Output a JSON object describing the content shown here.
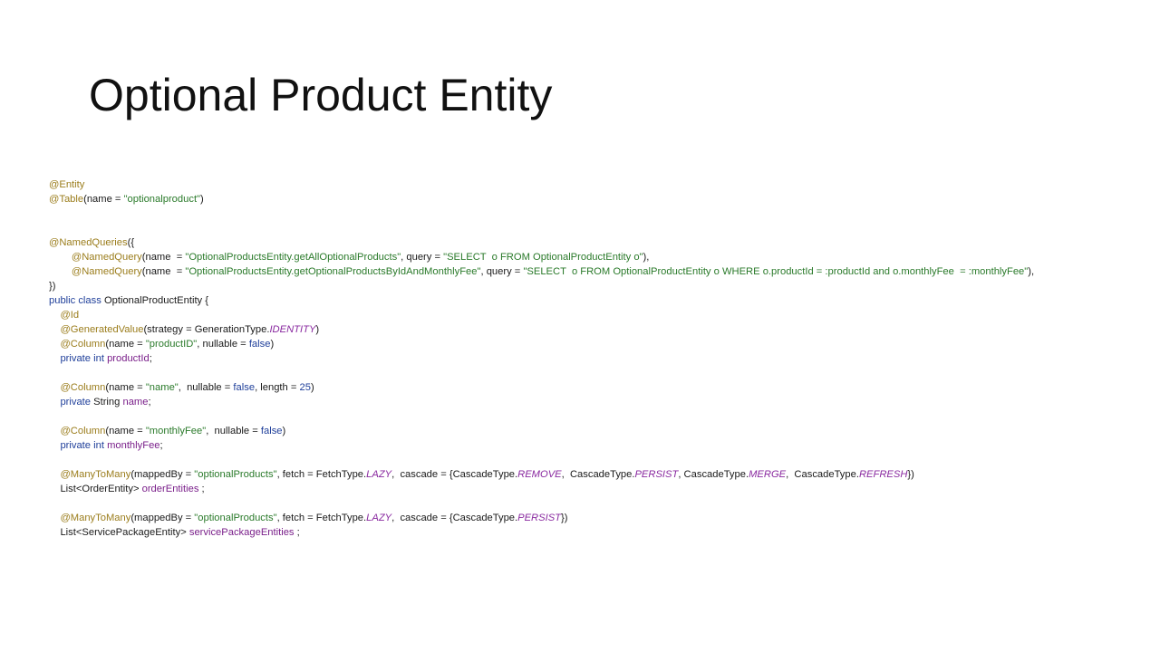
{
  "slide": {
    "title": "Optional Product Entity"
  },
  "colors": {
    "annotation": "#9b7d1c",
    "string": "#2a7a2a",
    "keyword": "#1f3f9a",
    "enum_constant": "#8a2aa0",
    "field": "#7a1f8a",
    "text": "#1a1a1a"
  },
  "code": {
    "lines": [
      {
        "tokens": [
          {
            "t": "@Entity",
            "c": "ann"
          }
        ]
      },
      {
        "tokens": [
          {
            "t": "@Table",
            "c": "ann"
          },
          {
            "t": "(name = ",
            "c": "plain"
          },
          {
            "t": "\"optionalproduct\"",
            "c": "str"
          },
          {
            "t": ")",
            "c": "plain"
          }
        ]
      },
      {
        "tokens": []
      },
      {
        "tokens": []
      },
      {
        "tokens": [
          {
            "t": "@NamedQueries",
            "c": "ann"
          },
          {
            "t": "({",
            "c": "plain"
          }
        ]
      },
      {
        "tokens": [
          {
            "t": "        ",
            "c": "plain"
          },
          {
            "t": "@NamedQuery",
            "c": "ann"
          },
          {
            "t": "(name  = ",
            "c": "plain"
          },
          {
            "t": "\"OptionalProductsEntity.getAllOptionalProducts\"",
            "c": "str"
          },
          {
            "t": ", query = ",
            "c": "plain"
          },
          {
            "t": "\"SELECT  o FROM OptionalProductEntity o\"",
            "c": "str"
          },
          {
            "t": "),",
            "c": "plain"
          }
        ]
      },
      {
        "tokens": [
          {
            "t": "        ",
            "c": "plain"
          },
          {
            "t": "@NamedQuery",
            "c": "ann"
          },
          {
            "t": "(name  = ",
            "c": "plain"
          },
          {
            "t": "\"OptionalProductsEntity.getOptionalProductsByIdAndMonthlyFee\"",
            "c": "str"
          },
          {
            "t": ", query = ",
            "c": "plain"
          },
          {
            "t": "\"SELECT  o FROM OptionalProductEntity o WHERE o.productId = :productId and o.monthlyFee  = :monthlyFee\"",
            "c": "str"
          },
          {
            "t": "),",
            "c": "plain"
          }
        ]
      },
      {
        "tokens": [
          {
            "t": "})",
            "c": "plain"
          }
        ]
      },
      {
        "tokens": [
          {
            "t": "public class ",
            "c": "kw"
          },
          {
            "t": "OptionalProductEntity {",
            "c": "plain"
          }
        ]
      },
      {
        "tokens": [
          {
            "t": "    ",
            "c": "plain"
          },
          {
            "t": "@Id",
            "c": "ann"
          }
        ]
      },
      {
        "tokens": [
          {
            "t": "    ",
            "c": "plain"
          },
          {
            "t": "@GeneratedValue",
            "c": "ann"
          },
          {
            "t": "(strategy = GenerationType.",
            "c": "plain"
          },
          {
            "t": "IDENTITY",
            "c": "const"
          },
          {
            "t": ")",
            "c": "plain"
          }
        ]
      },
      {
        "tokens": [
          {
            "t": "    ",
            "c": "plain"
          },
          {
            "t": "@Column",
            "c": "ann"
          },
          {
            "t": "(name = ",
            "c": "plain"
          },
          {
            "t": "\"productID\"",
            "c": "str"
          },
          {
            "t": ", nullable = ",
            "c": "plain"
          },
          {
            "t": "false",
            "c": "kw"
          },
          {
            "t": ")",
            "c": "plain"
          }
        ]
      },
      {
        "tokens": [
          {
            "t": "    ",
            "c": "plain"
          },
          {
            "t": "private int ",
            "c": "kw"
          },
          {
            "t": "productId",
            "c": "field"
          },
          {
            "t": ";",
            "c": "plain"
          }
        ]
      },
      {
        "tokens": []
      },
      {
        "tokens": [
          {
            "t": "    ",
            "c": "plain"
          },
          {
            "t": "@Column",
            "c": "ann"
          },
          {
            "t": "(name = ",
            "c": "plain"
          },
          {
            "t": "\"name\"",
            "c": "str"
          },
          {
            "t": ",  nullable = ",
            "c": "plain"
          },
          {
            "t": "false",
            "c": "kw"
          },
          {
            "t": ", length = ",
            "c": "plain"
          },
          {
            "t": "25",
            "c": "num"
          },
          {
            "t": ")",
            "c": "plain"
          }
        ]
      },
      {
        "tokens": [
          {
            "t": "    ",
            "c": "plain"
          },
          {
            "t": "private ",
            "c": "kw"
          },
          {
            "t": "String ",
            "c": "plain"
          },
          {
            "t": "name",
            "c": "field"
          },
          {
            "t": ";",
            "c": "plain"
          }
        ]
      },
      {
        "tokens": []
      },
      {
        "tokens": [
          {
            "t": "    ",
            "c": "plain"
          },
          {
            "t": "@Column",
            "c": "ann"
          },
          {
            "t": "(name = ",
            "c": "plain"
          },
          {
            "t": "\"monthlyFee\"",
            "c": "str"
          },
          {
            "t": ",  nullable = ",
            "c": "plain"
          },
          {
            "t": "false",
            "c": "kw"
          },
          {
            "t": ")",
            "c": "plain"
          }
        ]
      },
      {
        "tokens": [
          {
            "t": "    ",
            "c": "plain"
          },
          {
            "t": "private int ",
            "c": "kw"
          },
          {
            "t": "monthlyFee",
            "c": "field"
          },
          {
            "t": ";",
            "c": "plain"
          }
        ]
      },
      {
        "tokens": []
      },
      {
        "tokens": [
          {
            "t": "    ",
            "c": "plain"
          },
          {
            "t": "@ManyToMany",
            "c": "ann"
          },
          {
            "t": "(mappedBy = ",
            "c": "plain"
          },
          {
            "t": "\"optionalProducts\"",
            "c": "str"
          },
          {
            "t": ", fetch = FetchType.",
            "c": "plain"
          },
          {
            "t": "LAZY",
            "c": "const"
          },
          {
            "t": ",  cascade = {CascadeType.",
            "c": "plain"
          },
          {
            "t": "REMOVE",
            "c": "const"
          },
          {
            "t": ",  CascadeType.",
            "c": "plain"
          },
          {
            "t": "PERSIST",
            "c": "const"
          },
          {
            "t": ", CascadeType.",
            "c": "plain"
          },
          {
            "t": "MERGE",
            "c": "const"
          },
          {
            "t": ",  CascadeType.",
            "c": "plain"
          },
          {
            "t": "REFRESH",
            "c": "const"
          },
          {
            "t": "})",
            "c": "plain"
          }
        ]
      },
      {
        "tokens": [
          {
            "t": "    ",
            "c": "plain"
          },
          {
            "t": "List<OrderEntity> ",
            "c": "plain"
          },
          {
            "t": "orderEntities",
            "c": "field"
          },
          {
            "t": " ;",
            "c": "plain"
          }
        ]
      },
      {
        "tokens": []
      },
      {
        "tokens": [
          {
            "t": "    ",
            "c": "plain"
          },
          {
            "t": "@ManyToMany",
            "c": "ann"
          },
          {
            "t": "(mappedBy = ",
            "c": "plain"
          },
          {
            "t": "\"optionalProducts\"",
            "c": "str"
          },
          {
            "t": ", fetch = FetchType.",
            "c": "plain"
          },
          {
            "t": "LAZY",
            "c": "const"
          },
          {
            "t": ",  cascade = {CascadeType.",
            "c": "plain"
          },
          {
            "t": "PERSIST",
            "c": "const"
          },
          {
            "t": "})",
            "c": "plain"
          }
        ]
      },
      {
        "tokens": [
          {
            "t": "    ",
            "c": "plain"
          },
          {
            "t": "List<ServicePackageEntity> ",
            "c": "plain"
          },
          {
            "t": "servicePackageEntities",
            "c": "field"
          },
          {
            "t": " ;",
            "c": "plain"
          }
        ]
      }
    ]
  }
}
